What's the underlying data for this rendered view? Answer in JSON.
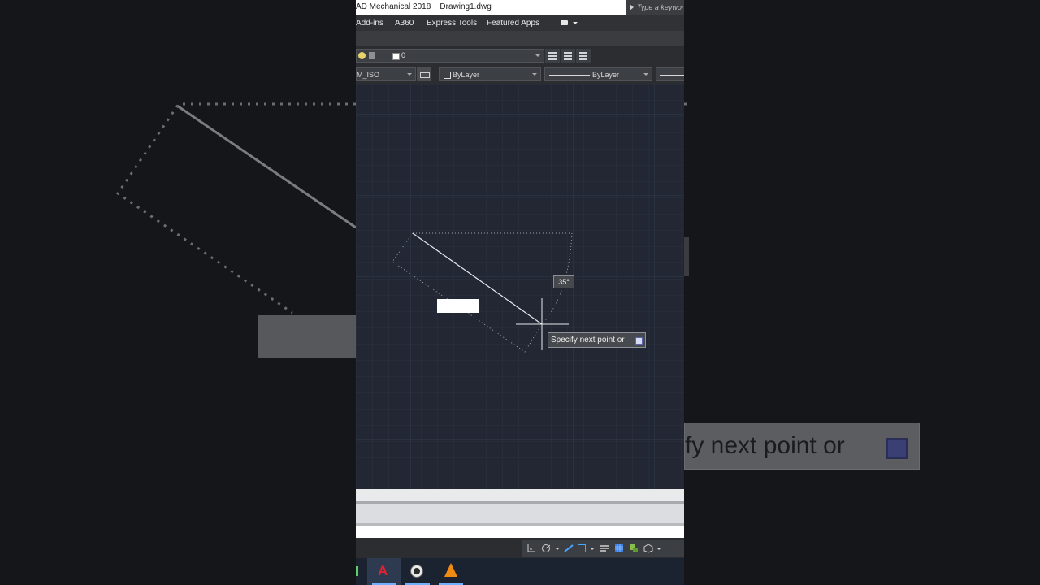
{
  "window": {
    "title": "AD Mechanical 2018    Drawing1.dwg",
    "search_placeholder": "Type a keyword"
  },
  "menu": {
    "items": [
      "Add-ins",
      "A360",
      "Express Tools",
      "Featured Apps"
    ]
  },
  "toolbar": {
    "current_layer": "0",
    "style_value": "M_ISO",
    "color_value": "ByLayer",
    "linetype_value": "ByLayer"
  },
  "drawing": {
    "angle_label": "35°",
    "prompt_text": "Specify next point or"
  },
  "background": {
    "zoomed_prompt_text": "fy next point or"
  },
  "taskbar": {
    "apps": [
      "autocad-icon",
      "obs-icon",
      "vlc-icon"
    ]
  },
  "colors": {
    "canvas": "#222733",
    "ui_dark": "#2b2d30",
    "accent_blue": "#6fb1ff",
    "autocad_red": "#e3202f"
  }
}
